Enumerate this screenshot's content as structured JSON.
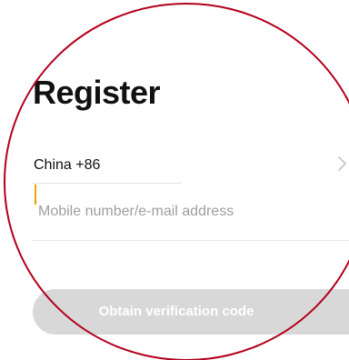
{
  "screen": {
    "title": "Register"
  },
  "country_selector": {
    "label": "China +86",
    "icon": "chevron-right-icon"
  },
  "account_field": {
    "value": "",
    "placeholder": "Mobile number/e-mail address"
  },
  "actions": {
    "obtain_code_label": "Obtain verification code",
    "obtain_code_enabled": false
  },
  "overlay": {
    "annotation_ring": "red-circle-annotation",
    "ring_color": "#b3001b"
  },
  "colors": {
    "caret": "#f2a200",
    "button_disabled": "#d8d8d8",
    "placeholder": "#9e9e9e",
    "text": "#111111"
  }
}
